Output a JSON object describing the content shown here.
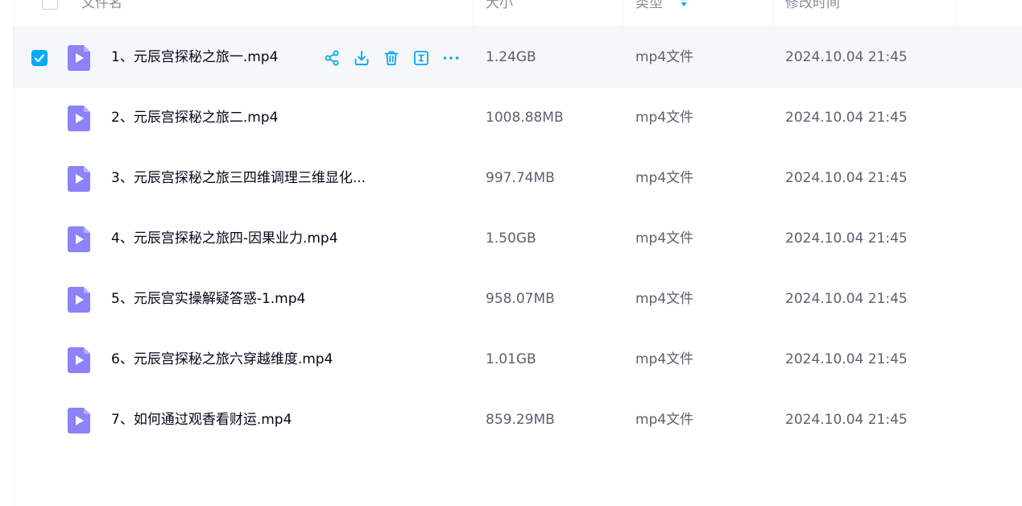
{
  "header": {
    "name": "文件名",
    "size": "大小",
    "type": "类型",
    "modified": "修改时间"
  },
  "colors": {
    "accent": "#06a7ff",
    "video_icon": "#8b83f7",
    "selected_row_bg": "#f6f7fb"
  },
  "action_icons": [
    "share-icon",
    "download-icon",
    "delete-icon",
    "rename-icon",
    "more-icon"
  ],
  "rows": [
    {
      "name": "1、元辰宫探秘之旅一.mp4",
      "size": "1.24GB",
      "type": "mp4文件",
      "modified": "2024.10.04 21:45",
      "selected": true
    },
    {
      "name": "2、元辰宫探秘之旅二.mp4",
      "size": "1008.88MB",
      "type": "mp4文件",
      "modified": "2024.10.04 21:45",
      "selected": false
    },
    {
      "name": "3、元辰宫探秘之旅三四维调理三维显化...",
      "size": "997.74MB",
      "type": "mp4文件",
      "modified": "2024.10.04 21:45",
      "selected": false
    },
    {
      "name": "4、元辰宫探秘之旅四-因果业力.mp4",
      "size": "1.50GB",
      "type": "mp4文件",
      "modified": "2024.10.04 21:45",
      "selected": false
    },
    {
      "name": "5、元辰宫实操解疑答惑-1.mp4",
      "size": "958.07MB",
      "type": "mp4文件",
      "modified": "2024.10.04 21:45",
      "selected": false
    },
    {
      "name": "6、元辰宫探秘之旅六穿越维度.mp4",
      "size": "1.01GB",
      "type": "mp4文件",
      "modified": "2024.10.04 21:45",
      "selected": false
    },
    {
      "name": "7、如何通过观香看财运.mp4",
      "size": "859.29MB",
      "type": "mp4文件",
      "modified": "2024.10.04 21:45",
      "selected": false
    }
  ]
}
